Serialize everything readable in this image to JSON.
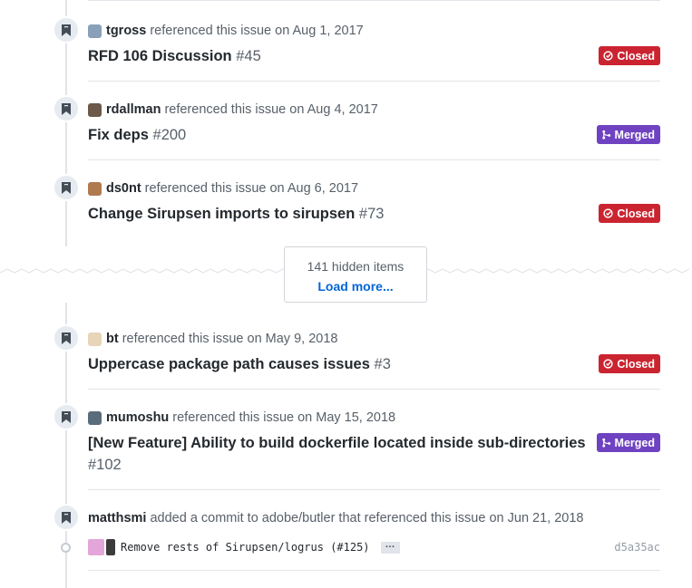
{
  "events": [
    {
      "author": "tgross",
      "action": "referenced this issue on Aug 1, 2017",
      "title": "RFD 106 Discussion",
      "number": "#45",
      "state": "Closed",
      "avatar_color": "#8aa0b8"
    },
    {
      "author": "rdallman",
      "action": "referenced this issue on Aug 4, 2017",
      "title": "Fix deps",
      "number": "#200",
      "state": "Merged",
      "avatar_color": "#6b5a4a"
    },
    {
      "author": "ds0nt",
      "action": "referenced this issue on Aug 6, 2017",
      "title": "Change Sirupsen imports to sirupsen",
      "number": "#73",
      "state": "Closed",
      "avatar_color": "#b07a4f"
    },
    {
      "author": "bt",
      "action": "referenced this issue on May 9, 2018",
      "title": "Uppercase package path causes issues",
      "number": "#3",
      "state": "Closed",
      "avatar_color": "#e8d4b8"
    },
    {
      "author": "mumoshu",
      "action": "referenced this issue on May 15, 2018",
      "title": "[New Feature] Ability to build dockerfile located inside sub-directories",
      "number": "#102",
      "state": "Merged",
      "avatar_color": "#5a6b7a"
    }
  ],
  "hidden": {
    "count_text": "141 hidden items",
    "load_more": "Load more..."
  },
  "commit_event": {
    "author": "matthsmi",
    "action": "added a commit to adobe/butler that referenced this issue on Jun 21, 2018",
    "message": "Remove rests of Sirupsen/logrus (#125)",
    "ellipsis": "…",
    "sha": "d5a35ac",
    "avatar_color": "#e3a6d8"
  },
  "colors": {
    "closed": "#cb2431",
    "merged": "#6f42c1",
    "link": "#0366d6"
  },
  "icons": {
    "badge": "bookmark-icon",
    "closed": "issue-closed-icon",
    "merged": "git-merge-icon"
  }
}
